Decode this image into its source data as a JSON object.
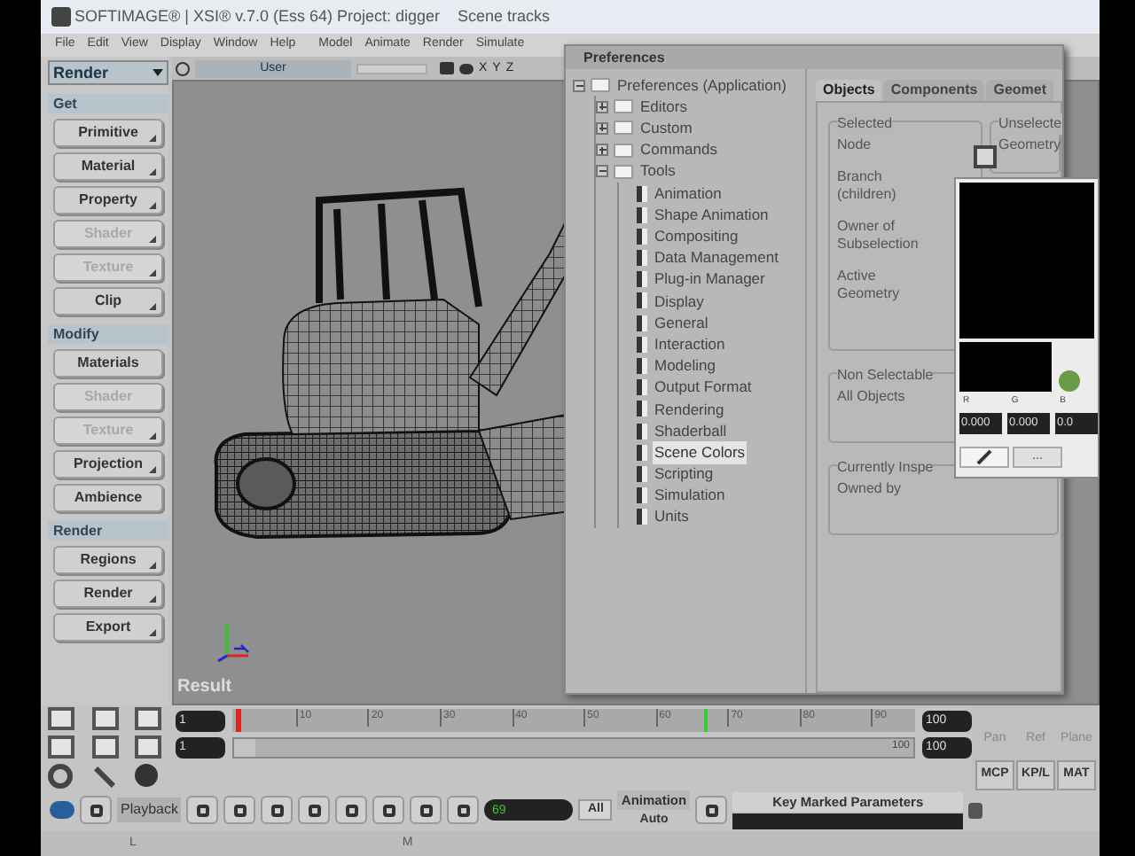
{
  "window": {
    "title": "SOFTIMAGE® | XSI® v.7.0 (Ess 64) Project: digger",
    "scene": "Scene tracks"
  },
  "menu": [
    "File",
    "Edit",
    "View",
    "Display",
    "Window",
    "Help",
    "Model",
    "Animate",
    "Render",
    "Simulate"
  ],
  "mode": "Render",
  "sections": [
    {
      "title": "Get",
      "buttons": [
        {
          "label": "Primitive",
          "disabled": false,
          "menu": true
        },
        {
          "label": "Material",
          "disabled": false,
          "menu": true
        },
        {
          "label": "Property",
          "disabled": false,
          "menu": true
        },
        {
          "label": "Shader",
          "disabled": true,
          "menu": true
        },
        {
          "label": "Texture",
          "disabled": true,
          "menu": true
        },
        {
          "label": "Clip",
          "disabled": false,
          "menu": true
        }
      ]
    },
    {
      "title": "Modify",
      "buttons": [
        {
          "label": "Materials",
          "disabled": false,
          "menu": false
        },
        {
          "label": "Shader",
          "disabled": true,
          "menu": false
        },
        {
          "label": "Texture",
          "disabled": true,
          "menu": true
        },
        {
          "label": "Projection",
          "disabled": false,
          "menu": true
        },
        {
          "label": "Ambience",
          "disabled": false,
          "menu": false
        }
      ]
    },
    {
      "title": "Render",
      "buttons": [
        {
          "label": "Regions",
          "disabled": false,
          "menu": true
        },
        {
          "label": "Render",
          "disabled": false,
          "menu": true
        },
        {
          "label": "Export",
          "disabled": false,
          "menu": true
        }
      ]
    }
  ],
  "viewport": {
    "camera": "User",
    "axes": [
      "X",
      "Y",
      "Z"
    ],
    "label": "Result"
  },
  "timeline": {
    "start": "1",
    "in": "1",
    "ticks": [
      "10",
      "20",
      "30",
      "40",
      "50",
      "60",
      "70",
      "80",
      "90"
    ],
    "level": 0.69,
    "range": {
      "level": 1
    },
    "end_label": "100",
    "end": "100",
    "out": "100"
  },
  "snap_panel": {
    "labels": [
      "Pan",
      "Ref",
      "Plane"
    ],
    "buttons": [
      "MCP",
      "KP/L",
      "MAT"
    ]
  },
  "playback": {
    "label": "Playback",
    "frame": "69",
    "all": "All",
    "animation": "Animation",
    "auto": "Auto",
    "key": "Key Marked Parameters"
  },
  "status": [
    "L",
    "M"
  ],
  "preferences": {
    "title": "Preferences",
    "tree": [
      {
        "label": "Preferences (Application)",
        "kind": "folder",
        "expanded": true,
        "selected": false,
        "children": [
          {
            "label": "Editors",
            "kind": "folder",
            "expanded": false,
            "selected": false
          },
          {
            "label": "Custom",
            "kind": "folder",
            "expanded": false,
            "selected": false
          },
          {
            "label": "Commands",
            "kind": "folder",
            "expanded": false,
            "selected": false
          },
          {
            "label": "Tools",
            "kind": "folder",
            "expanded": true,
            "selected": false,
            "children": [
              {
                "label": "Animation",
                "kind": "page",
                "selected": false
              },
              {
                "label": "Shape Animation",
                "kind": "page",
                "selected": false
              },
              {
                "label": "Compositing",
                "kind": "page",
                "selected": false
              },
              {
                "label": "Data Management",
                "kind": "page",
                "selected": false
              },
              {
                "label": "Plug-in Manager",
                "kind": "page",
                "selected": false
              },
              {
                "label": "Display",
                "kind": "page",
                "selected": false
              },
              {
                "label": "General",
                "kind": "page",
                "selected": false
              },
              {
                "label": "Interaction",
                "kind": "page",
                "selected": false
              },
              {
                "label": "Modeling",
                "kind": "page",
                "selected": false
              },
              {
                "label": "Output Format",
                "kind": "page",
                "selected": false
              },
              {
                "label": "Rendering",
                "kind": "page",
                "selected": false
              },
              {
                "label": "Shaderball",
                "kind": "page",
                "selected": false
              },
              {
                "label": "Scene Colors",
                "kind": "page",
                "selected": true
              },
              {
                "label": "Scripting",
                "kind": "page",
                "selected": false
              },
              {
                "label": "Simulation",
                "kind": "page",
                "selected": false
              },
              {
                "label": "Units",
                "kind": "page",
                "selected": false
              }
            ]
          }
        ]
      }
    ],
    "tabs": [
      {
        "label": "Objects",
        "selected": true
      },
      {
        "label": "Components",
        "selected": false
      },
      {
        "label": "Geomet",
        "selected": false
      }
    ],
    "selected_group": {
      "title": "Selected",
      "rows": [
        "Node",
        "Branch (children)",
        "Owner of Subselection",
        "Active Geometry"
      ]
    },
    "unselected_group": {
      "title": "Unselecte",
      "rows": [
        "Geometry"
      ]
    },
    "nonselectable_group": {
      "title": "Non Selectable",
      "rows": [
        "All Objects"
      ]
    },
    "inspected_group": {
      "title": "Currently Inspe",
      "rows": [
        "Owned by"
      ]
    },
    "color_picker": {
      "channels": [
        "R",
        "G",
        "B"
      ],
      "values": [
        "0.000",
        "0.000",
        "0.0"
      ],
      "more": "..."
    }
  }
}
